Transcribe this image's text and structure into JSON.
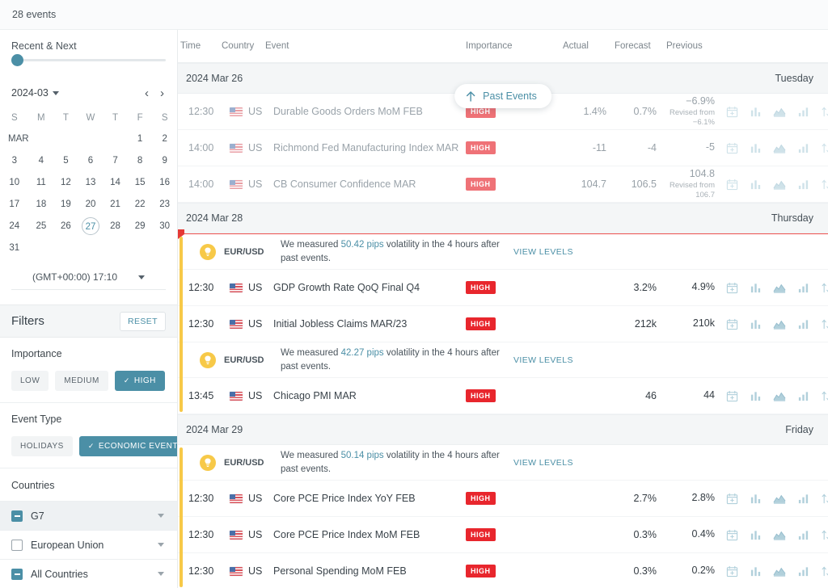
{
  "topbar": {
    "events_count": "28 events"
  },
  "sidebar": {
    "recent_label": "Recent & Next",
    "calendar": {
      "month_value": "2024-03",
      "prev_label": "‹",
      "next_label": "›",
      "weekdays": [
        "S",
        "M",
        "T",
        "W",
        "T",
        "F",
        "S"
      ],
      "month_abbr": "MAR",
      "today": "27",
      "weeks": [
        [
          "MAR",
          "",
          "",
          "",
          "",
          "1",
          "2"
        ],
        [
          "3",
          "4",
          "5",
          "6",
          "7",
          "8",
          "9"
        ],
        [
          "10",
          "11",
          "12",
          "13",
          "14",
          "15",
          "16"
        ],
        [
          "17",
          "18",
          "19",
          "20",
          "21",
          "22",
          "23"
        ],
        [
          "24",
          "25",
          "26",
          "27",
          "28",
          "29",
          "30"
        ],
        [
          "31",
          "",
          "",
          "",
          "",
          "",
          ""
        ]
      ]
    },
    "timezone": "(GMT+00:00) 17:10",
    "filters": {
      "title": "Filters",
      "reset_label": "RESET",
      "importance": {
        "title": "Importance",
        "options": [
          {
            "label": "LOW",
            "selected": false
          },
          {
            "label": "MEDIUM",
            "selected": false
          },
          {
            "label": "HIGH",
            "selected": true
          }
        ]
      },
      "event_type": {
        "title": "Event Type",
        "options": [
          {
            "label": "HOLIDAYS",
            "selected": false
          },
          {
            "label": "ECONOMIC EVENTS",
            "selected": true
          }
        ]
      },
      "countries": {
        "title": "Countries",
        "items": [
          {
            "label": "G7",
            "state": "indeterminate",
            "highlighted": true
          },
          {
            "label": "European Union",
            "state": "unchecked",
            "highlighted": false
          },
          {
            "label": "All Countries",
            "state": "indeterminate",
            "highlighted": false
          }
        ]
      }
    }
  },
  "main": {
    "past_events_pill": "Past Events",
    "columns": {
      "time": "Time",
      "country": "Country",
      "event": "Event",
      "importance": "Importance",
      "actual": "Actual",
      "forecast": "Forecast",
      "previous": "Previous"
    },
    "row_icons": [
      "calendar-plus-icon",
      "bar-chart-icon",
      "area-chart-icon",
      "histogram-icon",
      "sort-arrows-icon"
    ],
    "groups": [
      {
        "date": "2024 Mar 26",
        "weekday": "Tuesday",
        "is_future": false,
        "show_now_line": false,
        "rows": [
          {
            "kind": "event",
            "past": true,
            "time": "12:30",
            "country": "US",
            "name": "Durable Goods Orders MoM FEB",
            "importance": "HIGH",
            "actual": "1.4%",
            "forecast": "0.7%",
            "previous": "−6.9%",
            "revised_label": "Revised from",
            "revised_value": "−6.1%"
          },
          {
            "kind": "event",
            "past": true,
            "time": "14:00",
            "country": "US",
            "name": "Richmond Fed Manufacturing Index MAR",
            "importance": "HIGH",
            "actual": "-11",
            "forecast": "-4",
            "previous": "-5",
            "revised_label": "",
            "revised_value": ""
          },
          {
            "kind": "event",
            "past": true,
            "time": "14:00",
            "country": "US",
            "name": "CB Consumer Confidence MAR",
            "importance": "HIGH",
            "actual": "104.7",
            "forecast": "106.5",
            "previous": "104.8",
            "revised_label": "Revised from",
            "revised_value": "106.7"
          }
        ]
      },
      {
        "date": "2024 Mar 28",
        "weekday": "Thursday",
        "is_future": true,
        "show_now_line": true,
        "rows": [
          {
            "kind": "volatility",
            "pair": "EUR/USD",
            "text_before": "We measured ",
            "pips": "50.42 pips",
            "text_after": " volatility in the 4 hours after past events.",
            "link": "VIEW LEVELS"
          },
          {
            "kind": "event",
            "past": false,
            "time": "12:30",
            "country": "US",
            "name": "GDP Growth Rate QoQ Final Q4",
            "importance": "HIGH",
            "actual": "",
            "forecast": "3.2%",
            "previous": "4.9%",
            "revised_label": "",
            "revised_value": ""
          },
          {
            "kind": "event",
            "past": false,
            "time": "12:30",
            "country": "US",
            "name": "Initial Jobless Claims MAR/23",
            "importance": "HIGH",
            "actual": "",
            "forecast": "212k",
            "previous": "210k",
            "revised_label": "",
            "revised_value": ""
          },
          {
            "kind": "volatility",
            "pair": "EUR/USD",
            "text_before": "We measured ",
            "pips": "42.27 pips",
            "text_after": " volatility in the 4 hours after past events.",
            "link": "VIEW LEVELS"
          },
          {
            "kind": "event",
            "past": false,
            "time": "13:45",
            "country": "US",
            "name": "Chicago PMI MAR",
            "importance": "HIGH",
            "actual": "",
            "forecast": "46",
            "previous": "44",
            "revised_label": "",
            "revised_value": ""
          }
        ]
      },
      {
        "date": "2024 Mar 29",
        "weekday": "Friday",
        "is_future": true,
        "show_now_line": false,
        "rows": [
          {
            "kind": "volatility",
            "pair": "EUR/USD",
            "text_before": "We measured ",
            "pips": "50.14 pips",
            "text_after": " volatility in the 4 hours after past events.",
            "link": "VIEW LEVELS"
          },
          {
            "kind": "event",
            "past": false,
            "time": "12:30",
            "country": "US",
            "name": "Core PCE Price Index YoY FEB",
            "importance": "HIGH",
            "actual": "",
            "forecast": "2.7%",
            "previous": "2.8%",
            "revised_label": "",
            "revised_value": ""
          },
          {
            "kind": "event",
            "past": false,
            "time": "12:30",
            "country": "US",
            "name": "Core PCE Price Index MoM FEB",
            "importance": "HIGH",
            "actual": "",
            "forecast": "0.3%",
            "previous": "0.4%",
            "revised_label": "",
            "revised_value": ""
          },
          {
            "kind": "event",
            "past": false,
            "time": "12:30",
            "country": "US",
            "name": "Personal Spending MoM FEB",
            "importance": "HIGH",
            "actual": "",
            "forecast": "0.3%",
            "previous": "0.2%",
            "revised_label": "",
            "revised_value": ""
          }
        ]
      }
    ]
  },
  "colors": {
    "accent_teal": "#4b8fa6",
    "high_red": "#e8262d",
    "future_yellow": "#f7c948",
    "now_line_red": "#ef5350"
  }
}
